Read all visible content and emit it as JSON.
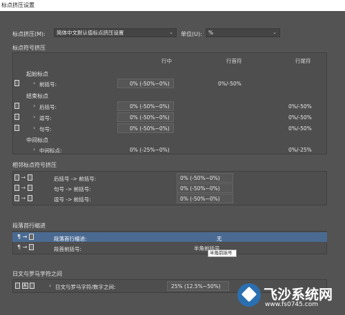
{
  "window": {
    "title": "标点挤压设置"
  },
  "header": {
    "mojikumi_label": "标点挤压(M):",
    "mojikumi_value": "简体中文默认值标点挤压设置",
    "unit_label": "单位(U):",
    "unit_value": "%"
  },
  "punct_section": {
    "title": "标点符号挤压",
    "columns": [
      "行中",
      "行首符",
      "行尾符"
    ],
    "groups": [
      {
        "title": "起始标点",
        "rows": [
          {
            "label": "前括号:",
            "mid": "0% (-50%~0%)",
            "start": "0%/-50%",
            "end": ""
          }
        ]
      },
      {
        "title": "结束标点",
        "rows": [
          {
            "label": "后括号:",
            "mid": "0% (-50%~0%)",
            "start": "",
            "end": "0%/-50%"
          },
          {
            "label": "逗号:",
            "mid": "0% (-50%~0%)",
            "start": "",
            "end": "0%/-50%"
          },
          {
            "label": "句号:",
            "mid": "0% (-50%~0%)",
            "start": "",
            "end": "0%/-50%"
          }
        ]
      },
      {
        "title": "中间标点",
        "rows": [
          {
            "label": "中间标点:",
            "mid": "0% (-25%~0%)",
            "start": "",
            "end": "0%/-25%"
          }
        ]
      }
    ]
  },
  "adjacent_section": {
    "title": "相邻标点符号挤压",
    "rows": [
      {
        "label": "后括号 -> 前括号:",
        "value": "0% (-50%~0%)"
      },
      {
        "label": "句号 -> 前括号:",
        "value": "0% (-50%~0%)"
      },
      {
        "label": "逗号 -> 前括号:",
        "value": "0% (-50%~0%)"
      }
    ]
  },
  "indent_section": {
    "title": "段落首行缩进",
    "rows": [
      {
        "label": "段落首行缩进:",
        "value": "无",
        "selected": true
      },
      {
        "label": "段首前括号:",
        "value": "半角前括号",
        "selected": false
      }
    ],
    "tooltip": "半角前括号"
  },
  "roman_section": {
    "title": "日文与罗马字符之间",
    "icon_text": "A",
    "row": {
      "label": "日文与罗马字符/数字之间:",
      "value": "25% (12.5%~50%)"
    }
  },
  "watermark": {
    "brand": "飞沙系统网",
    "url": "www.fs0745.com"
  },
  "colors": {
    "background": "#535353",
    "highlight": "#4a6a91",
    "titlebar": "#ffffff"
  }
}
